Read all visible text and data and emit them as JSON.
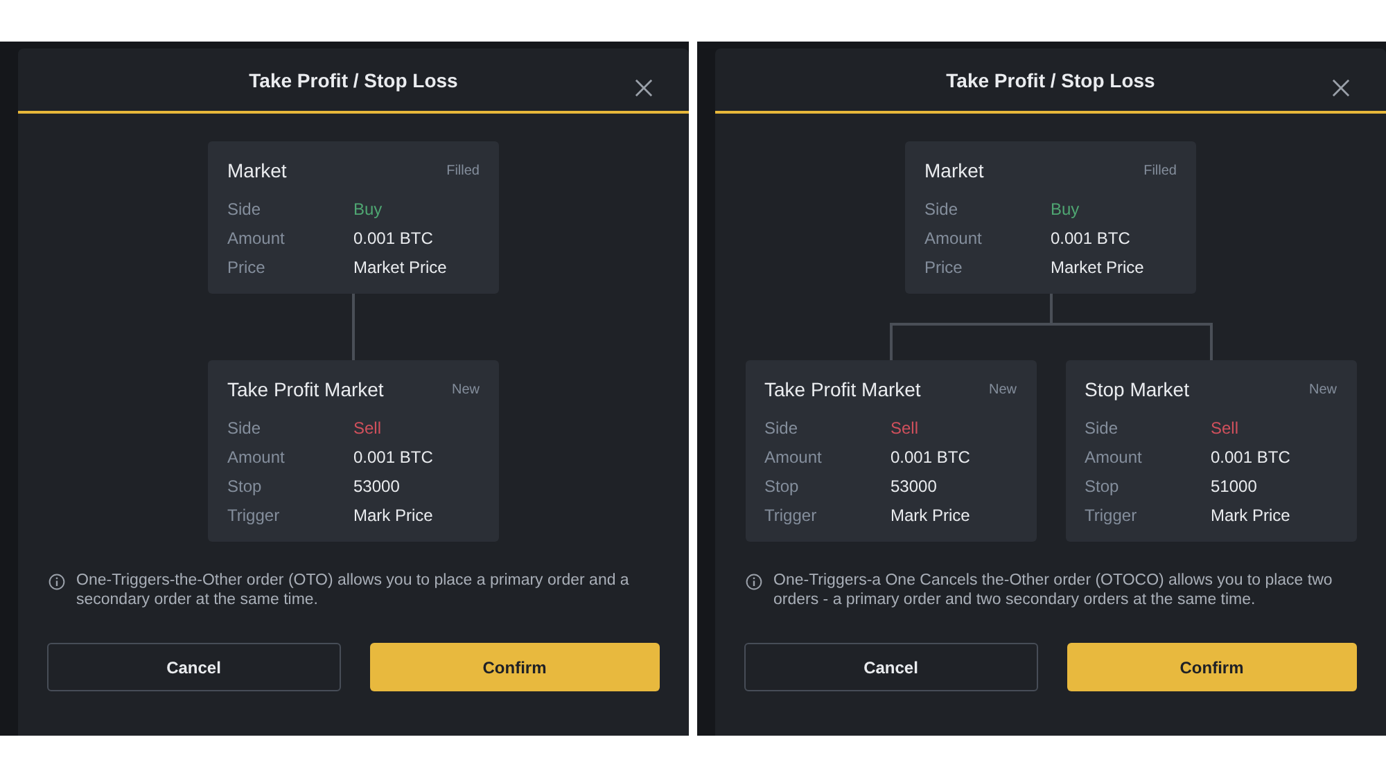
{
  "dialogs": [
    {
      "title": "Take Profit / Stop Loss",
      "primary": {
        "name": "Market",
        "status": "Filled",
        "fields": [
          {
            "label": "Side",
            "value": "Buy",
            "kind": "buy"
          },
          {
            "label": "Amount",
            "value": "0.001 BTC",
            "kind": "plain"
          },
          {
            "label": "Price",
            "value": "Market Price",
            "kind": "plain"
          }
        ]
      },
      "secondary": [
        {
          "name": "Take Profit Market",
          "status": "New",
          "fields": [
            {
              "label": "Side",
              "value": "Sell",
              "kind": "sell"
            },
            {
              "label": "Amount",
              "value": "0.001 BTC",
              "kind": "plain"
            },
            {
              "label": "Stop",
              "value": "53000",
              "kind": "plain"
            },
            {
              "label": "Trigger",
              "value": "Mark Price",
              "kind": "plain"
            }
          ]
        }
      ],
      "note": "One-Triggers-the-Other order (OTO) allows you to place a primary order and a secondary order at the same time.",
      "buttons": [
        {
          "label": "Cancel",
          "kind": "secondary"
        },
        {
          "label": "Confirm",
          "kind": "primary"
        }
      ]
    },
    {
      "title": "Take Profit / Stop Loss",
      "primary": {
        "name": "Market",
        "status": "Filled",
        "fields": [
          {
            "label": "Side",
            "value": "Buy",
            "kind": "buy"
          },
          {
            "label": "Amount",
            "value": "0.001 BTC",
            "kind": "plain"
          },
          {
            "label": "Price",
            "value": "Market Price",
            "kind": "plain"
          }
        ]
      },
      "secondary": [
        {
          "name": "Take Profit Market",
          "status": "New",
          "fields": [
            {
              "label": "Side",
              "value": "Sell",
              "kind": "sell"
            },
            {
              "label": "Amount",
              "value": "0.001 BTC",
              "kind": "plain"
            },
            {
              "label": "Stop",
              "value": "53000",
              "kind": "plain"
            },
            {
              "label": "Trigger",
              "value": "Mark Price",
              "kind": "plain"
            }
          ]
        },
        {
          "name": "Stop Market",
          "status": "New",
          "fields": [
            {
              "label": "Side",
              "value": "Sell",
              "kind": "sell"
            },
            {
              "label": "Amount",
              "value": "0.001 BTC",
              "kind": "plain"
            },
            {
              "label": "Stop",
              "value": "51000",
              "kind": "plain"
            },
            {
              "label": "Trigger",
              "value": "Mark Price",
              "kind": "plain"
            }
          ]
        }
      ],
      "note": "One-Triggers-a One Cancels the-Other order (OTOCO) allows you to place two orders - a primary order and two secondary orders at the same time.",
      "buttons": [
        {
          "label": "Cancel",
          "kind": "secondary"
        },
        {
          "label": "Confirm",
          "kind": "primary"
        }
      ]
    }
  ]
}
